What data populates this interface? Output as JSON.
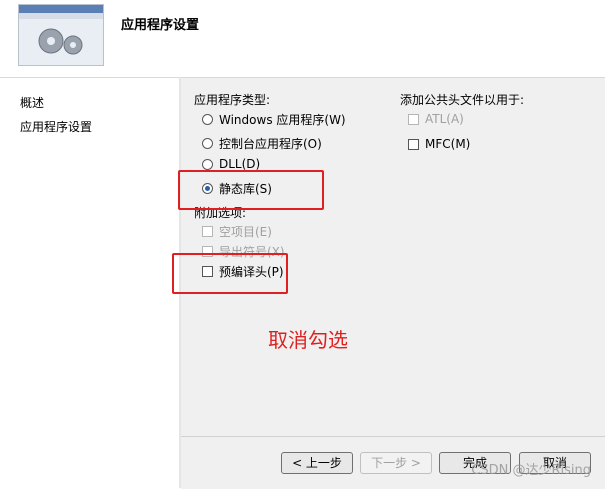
{
  "header": {
    "title": "应用程序设置"
  },
  "nav": [
    {
      "label": "概述"
    },
    {
      "label": "应用程序设置"
    }
  ],
  "app_type": {
    "label": "应用程序类型:",
    "options": [
      {
        "label": "Windows 应用程序(W)",
        "selected": false
      },
      {
        "label": "控制台应用程序(O)",
        "selected": false
      },
      {
        "label": "DLL(D)",
        "selected": false
      },
      {
        "label": "静态库(S)",
        "selected": true
      }
    ]
  },
  "extra": {
    "label": "附加选项:",
    "options": [
      {
        "label": "空项目(E)",
        "enabled": false,
        "checked": false
      },
      {
        "label": "导出符号(X)",
        "enabled": false,
        "checked": false
      },
      {
        "label": "预编译头(P)",
        "enabled": true,
        "checked": false
      }
    ]
  },
  "headers": {
    "label": "添加公共头文件以用于:",
    "options": [
      {
        "label": "ATL(A)",
        "enabled": false,
        "checked": false
      },
      {
        "label": "MFC(M)",
        "enabled": true,
        "checked": false
      }
    ]
  },
  "annotation": "取消勾选",
  "buttons": {
    "prev": "< 上一步",
    "next": "下一步 >",
    "finish": "完成",
    "cancel": "取消"
  },
  "watermark": "CSDN @达少Rising",
  "colors": {
    "highlight": "#e02020",
    "content_bg": "#f0f0f0"
  }
}
